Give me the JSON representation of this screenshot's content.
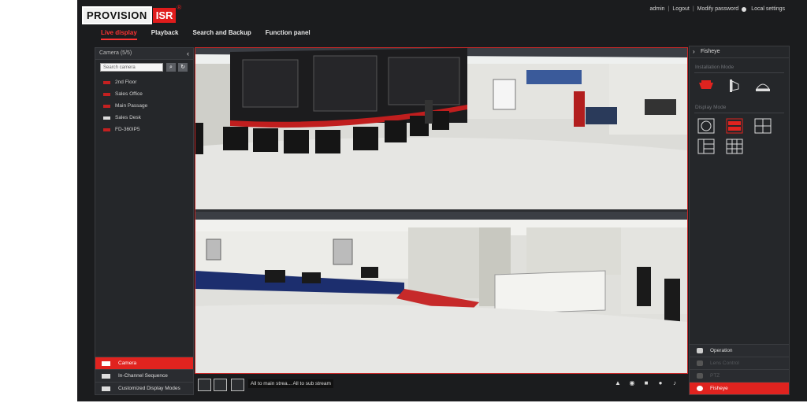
{
  "brand": {
    "logo_left": "PROVISION",
    "logo_right": "ISR",
    "reg": "®"
  },
  "top_links": {
    "user": "admin",
    "logout": "Logout",
    "modify_password": "Modify password",
    "local_settings": "Local settings"
  },
  "nav_tabs": [
    {
      "label": "Live display",
      "active": true
    },
    {
      "label": "Playback"
    },
    {
      "label": "Search and Backup"
    },
    {
      "label": "Function panel"
    }
  ],
  "camera_panel": {
    "header": "Camera (5/5)",
    "search_placeholder": "Search camera",
    "cameras": [
      {
        "name": "2nd Floor",
        "icon": "camera-icon"
      },
      {
        "name": "Sales Office",
        "icon": "camera-icon"
      },
      {
        "name": "Main Passage",
        "icon": "camera-icon"
      },
      {
        "name": "Sales Desk",
        "icon": "camera-icon"
      },
      {
        "name": "FD-360IP5",
        "icon": "camera-icon"
      }
    ],
    "bottom_items": [
      {
        "label": "Camera",
        "active": true
      },
      {
        "label": "In-Channel Sequence"
      },
      {
        "label": "Customized Display Modes"
      }
    ]
  },
  "stream_buttons": {
    "main": "All to main strea...",
    "sub": "All to sub stream"
  },
  "right_panel": {
    "header": "Fisheye",
    "installation_mode": "Installation Mode",
    "display_mode": "Display Mode",
    "bottom_items": [
      {
        "label": "Operation",
        "dim": false
      },
      {
        "label": "Lens Control",
        "dim": true
      },
      {
        "label": "PTZ",
        "dim": true
      },
      {
        "label": "Fisheye",
        "active": true
      }
    ]
  },
  "colors": {
    "accent": "#e0231f",
    "background": "#1b1c1e",
    "panel": "#25272a"
  }
}
